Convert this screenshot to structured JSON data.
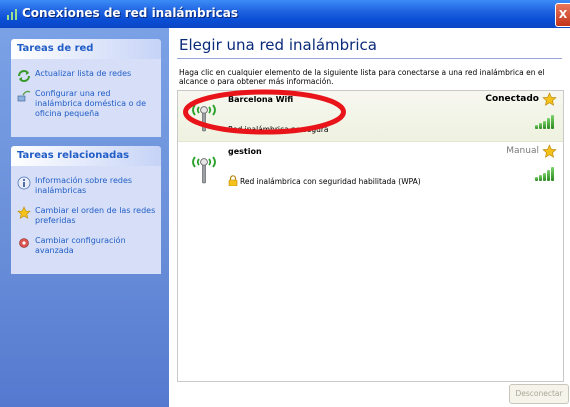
{
  "window": {
    "title": "Conexiones de red inalámbricas",
    "close_glyph": "X"
  },
  "sidebar": {
    "network_tasks": {
      "heading": "Tareas de red",
      "items": [
        {
          "label": "Actualizar lista de redes",
          "icon": "refresh-icon"
        },
        {
          "label": "Configurar una red inalámbrica doméstica o de oficina pequeña",
          "icon": "wizard-icon"
        }
      ]
    },
    "related_tasks": {
      "heading": "Tareas relacionadas",
      "items": [
        {
          "label": "Información sobre redes inalámbricas",
          "icon": "info-icon"
        },
        {
          "label": "Cambiar el orden de las redes preferidas",
          "icon": "star-icon"
        },
        {
          "label": "Cambiar configuración avanzada",
          "icon": "settings-icon"
        }
      ]
    }
  },
  "main": {
    "title": "Elegir una red inalámbrica",
    "instructions": "Haga clic en cualquier elemento de la siguiente lista para conectarse a una red inalámbrica en el alcance o para obtener más información.",
    "networks": [
      {
        "name": "Barcelona Wifi",
        "status": "Conectado",
        "description": "Red inalámbrica no segura",
        "selected": true,
        "signal_bars": 5
      },
      {
        "name": "gestion",
        "status": "Manual",
        "description": "Red inalámbrica con seguridad habilitada (WPA)",
        "selected": false,
        "signal_bars": 5
      }
    ],
    "disconnect_label": "Desconectar"
  },
  "colors": {
    "titlebar": "#0a4fd6",
    "sidebar": "#6a8fd9",
    "link": "#215dc6",
    "annotation": "#e8141a"
  }
}
